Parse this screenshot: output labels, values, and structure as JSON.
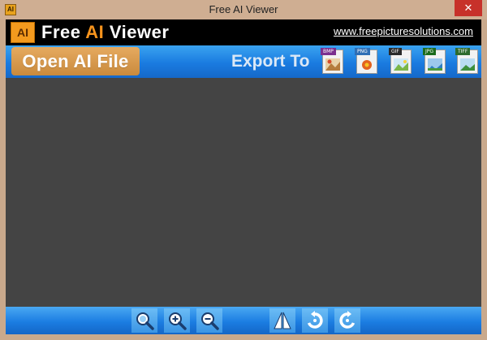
{
  "window": {
    "title": "Free AI Viewer",
    "close_glyph": "✕",
    "icon_text": "AI"
  },
  "header": {
    "logo_text": "AI",
    "brand_part1": "Free ",
    "brand_accent": "AI",
    "brand_part2": " Viewer",
    "website": "www.freepicturesolutions.com"
  },
  "toolbar": {
    "open_label": "Open AI File",
    "export_label": "Export To",
    "formats": [
      {
        "label": "BMP",
        "color": "#7b2f8f"
      },
      {
        "label": "PNG",
        "color": "#2e6eb5"
      },
      {
        "label": "GIF",
        "color": "#2a2a2a"
      },
      {
        "label": "JPG",
        "color": "#1c6b1c"
      },
      {
        "label": "TIFF",
        "color": "#2d6b2d"
      }
    ]
  },
  "bottom_toolbar": {
    "icons": [
      "zoom-fit-icon",
      "zoom-in-icon",
      "zoom-out-icon",
      "flip-icon",
      "rotate-left-icon",
      "rotate-right-icon"
    ]
  },
  "colors": {
    "accent": "#f7941d",
    "toolbar_blue": "#1a7be0",
    "canvas": "#444444"
  }
}
